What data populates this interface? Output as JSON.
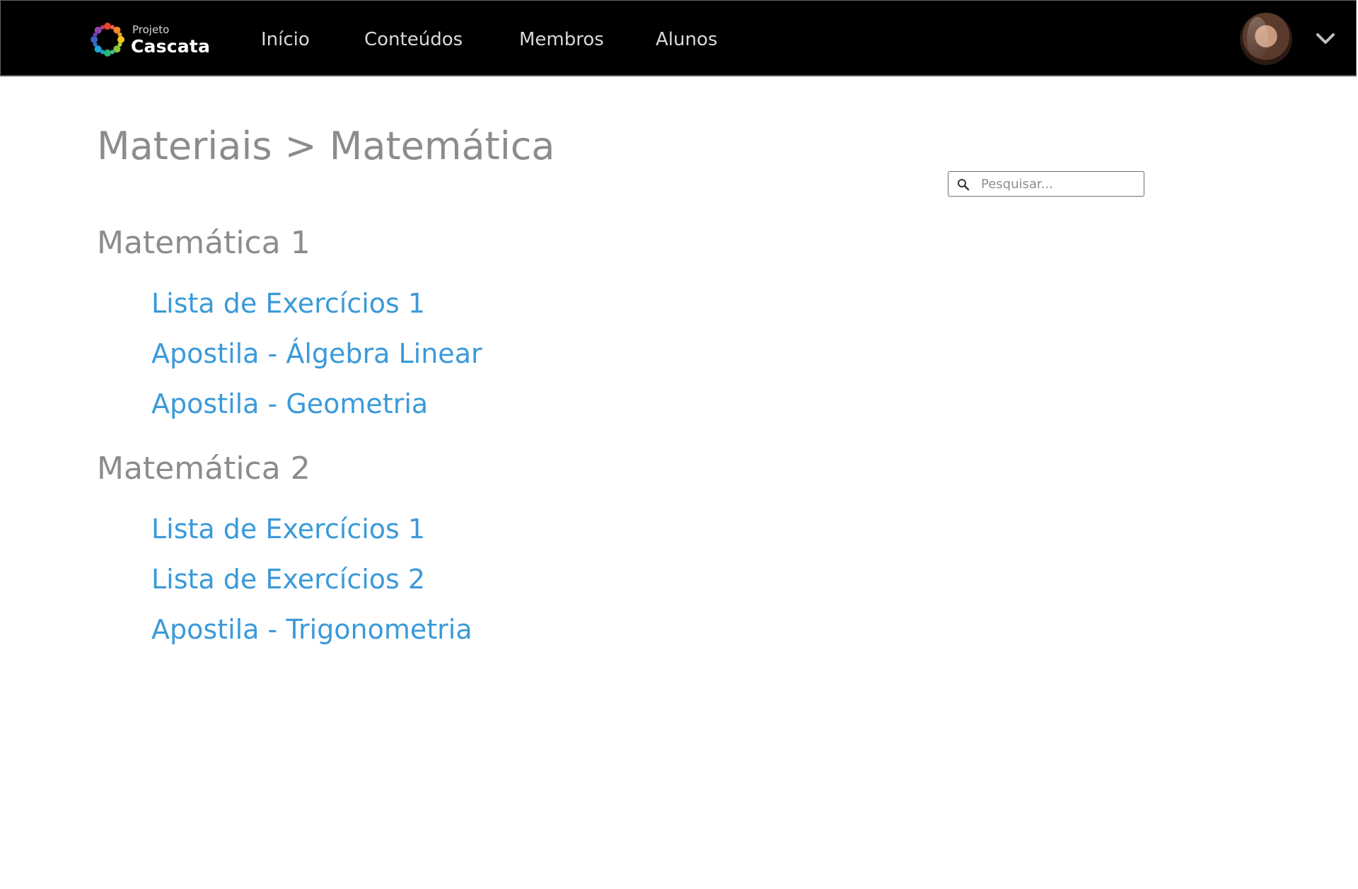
{
  "header": {
    "logo": {
      "small_text": "Projeto",
      "big_text": "Cascata"
    },
    "nav": [
      {
        "label": "Início"
      },
      {
        "label": "Conteúdos"
      },
      {
        "label": "Membros"
      },
      {
        "label": "Alunos"
      }
    ],
    "user_menu_icon": "chevron-down-icon"
  },
  "page": {
    "breadcrumb": {
      "root": "Materiais",
      "separator": ">",
      "current": "Matemática"
    },
    "search": {
      "placeholder": "Pesquisar...",
      "value": "",
      "icon": "search-icon"
    },
    "sections": [
      {
        "title": "Matemática 1",
        "items": [
          {
            "label": "Lista de Exercícios 1"
          },
          {
            "label": "Apostila - Álgebra Linear"
          },
          {
            "label": "Apostila - Geometria"
          }
        ]
      },
      {
        "title": "Matemática 2",
        "items": [
          {
            "label": "Lista de Exercícios 1"
          },
          {
            "label": "Lista de Exercícios 2"
          },
          {
            "label": "Apostila - Trigonometria"
          }
        ]
      }
    ]
  },
  "colors": {
    "header_bg": "#000000",
    "nav_text": "#d9d9d9",
    "heading_text": "#8c8c8c",
    "link": "#3a9ad9"
  }
}
